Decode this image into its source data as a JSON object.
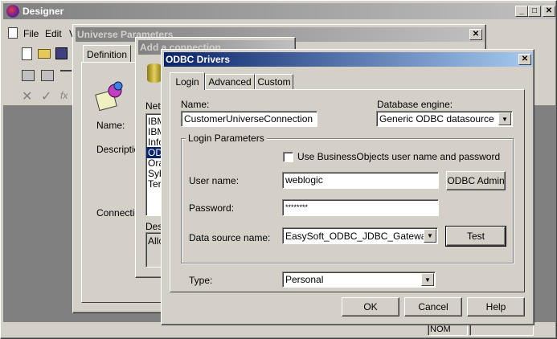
{
  "designer": {
    "title": "Designer",
    "menu": [
      "File",
      "Edit",
      "V"
    ],
    "status_nom": "NOM"
  },
  "universe_params": {
    "title": "Universe Parameters",
    "tab_definition": "Definition",
    "label_name": "Name:",
    "label_description": "Description",
    "label_connection": "Connection"
  },
  "add_connection": {
    "title": "Add a connection",
    "label_network": "Netw",
    "drivers": [
      "IBM",
      "IBM",
      "Info",
      "ODE",
      "Ora",
      "Syb",
      "Ter"
    ],
    "label_description": "Des",
    "description_value": "Allo"
  },
  "odbc": {
    "title": "ODBC Drivers",
    "tabs": [
      "Login",
      "Advanced",
      "Custom"
    ],
    "label_name": "Name:",
    "name_value": "CustomerUniverseConnection",
    "label_engine": "Database engine:",
    "engine_value": "Generic ODBC datasource",
    "login_params_label": "Login Parameters",
    "use_bo_checkbox": "Use BusinessObjects user name and password",
    "label_username": "User name:",
    "username_value": "weblogic",
    "odbc_admin_button": "ODBC Admin",
    "label_password": "Password:",
    "password_value": "********",
    "label_datasource": "Data source name:",
    "datasource_value": "EasySoft_ODBC_JDBC_Gateway",
    "test_button": "Test",
    "label_type": "Type:",
    "type_value": "Personal",
    "ok_button": "OK",
    "cancel_button": "Cancel",
    "help_button": "Help"
  }
}
